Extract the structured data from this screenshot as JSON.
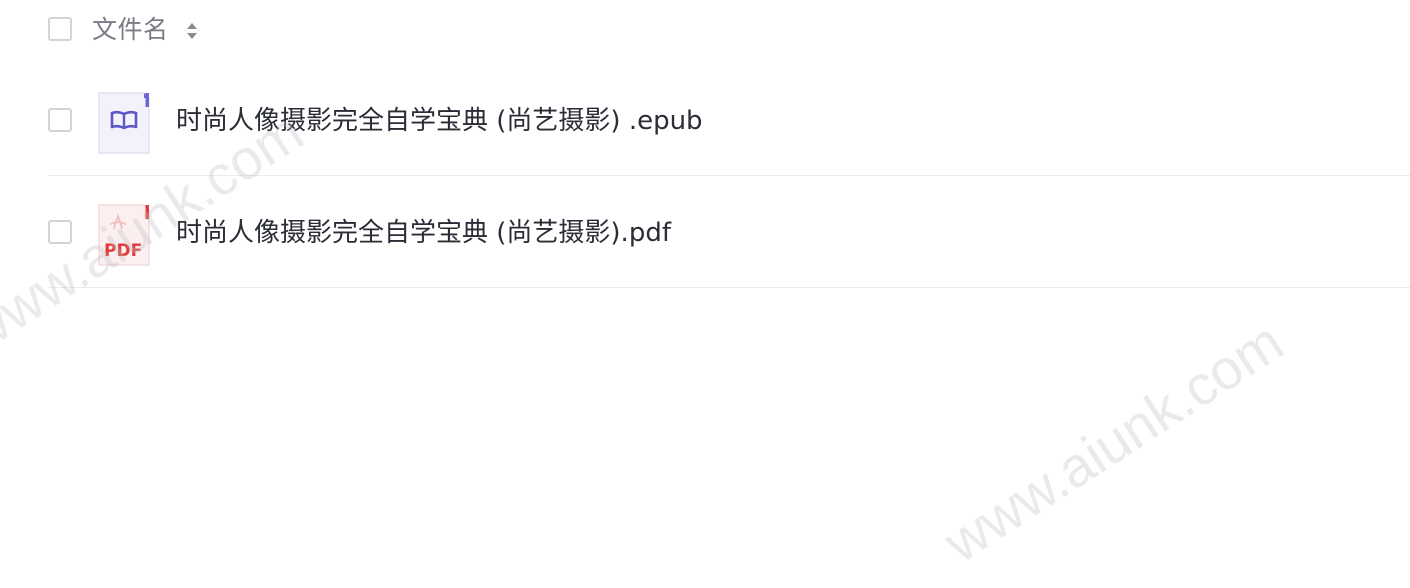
{
  "header": {
    "column_label": "文件名",
    "sort_icon": "sort-toggle-icon"
  },
  "files": [
    {
      "name": "时尚人像摄影完全自学宝典 (尚艺摄影) .epub",
      "icon": "epub-book-icon",
      "icon_color": "#5b57c9"
    },
    {
      "name": "时尚人像摄影完全自学宝典 (尚艺摄影).pdf",
      "icon": "pdf-icon",
      "icon_label": "PDF",
      "icon_color": "#e23a3a"
    }
  ],
  "watermarks": [
    "www.aiunk.com",
    "www.aiunk.com"
  ]
}
